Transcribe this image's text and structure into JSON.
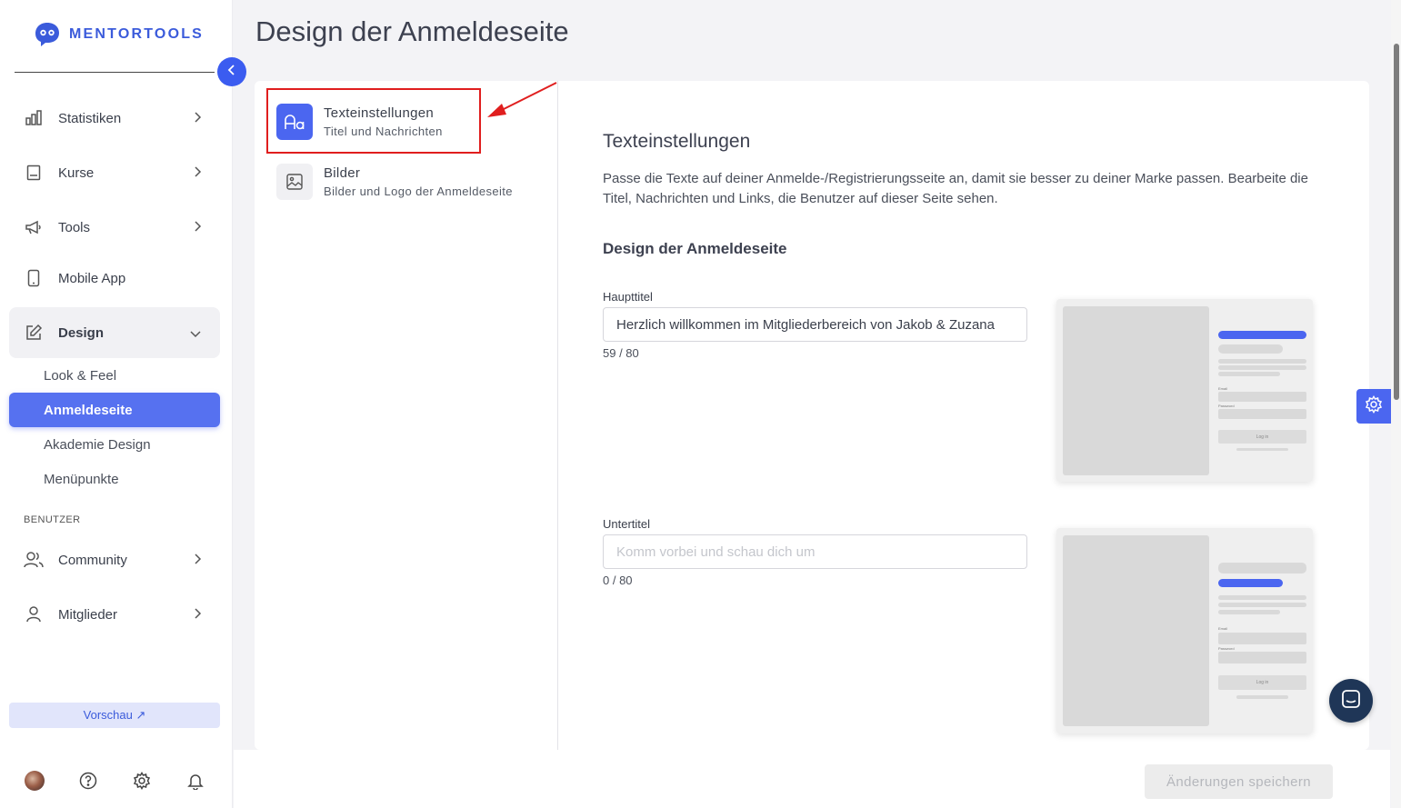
{
  "brand": {
    "name": "MENTORTOOLS",
    "accent": "#3b5cf0"
  },
  "sidebar": {
    "items": [
      {
        "label": "Statistiken",
        "icon": "bar-chart-icon"
      },
      {
        "label": "Kurse",
        "icon": "book-icon"
      },
      {
        "label": "Tools",
        "icon": "megaphone-icon"
      },
      {
        "label": "Mobile App",
        "icon": "mobile-icon"
      },
      {
        "label": "Design",
        "icon": "edit-icon"
      }
    ],
    "design_sub": [
      "Look & Feel",
      "Anmeldeseite",
      "Akademie Design",
      "Menüpunkte"
    ],
    "section_users": "BENUTZER",
    "user_items": [
      {
        "label": "Community",
        "icon": "users-icon"
      },
      {
        "label": "Mitglieder",
        "icon": "user-icon"
      }
    ],
    "preview_label": "Vorschau ↗"
  },
  "page": {
    "title": "Design der Anmeldeseite",
    "tabs": [
      {
        "title": "Texteinstellungen",
        "subtitle": "Titel und Nachrichten",
        "icon": "typography-icon"
      },
      {
        "title": "Bilder",
        "subtitle": "Bilder und Logo der Anmeldeseite",
        "icon": "image-icon"
      }
    ],
    "section_title": "Texteinstellungen",
    "description": "Passe die Texte auf deiner Anmelde-/Registrierungsseite an, damit sie besser zu deiner Marke passen. Bearbeite die Titel, Nachrichten und Links, die Benutzer auf dieser Seite sehen.",
    "subsection_title": "Design der Anmeldeseite",
    "fields": {
      "main_title": {
        "label": "Haupttitel",
        "value": "Herzlich willkommen im Mitgliederbereich von Jakob & Zuzana",
        "counter": "59 / 80"
      },
      "subtitle": {
        "label": "Untertitel",
        "placeholder": "Komm vorbei und schau dich um",
        "counter": "0 / 80"
      }
    },
    "mockup": {
      "email": "Email",
      "password": "Password",
      "login": "Log in"
    },
    "save_label": "Änderungen speichern"
  }
}
